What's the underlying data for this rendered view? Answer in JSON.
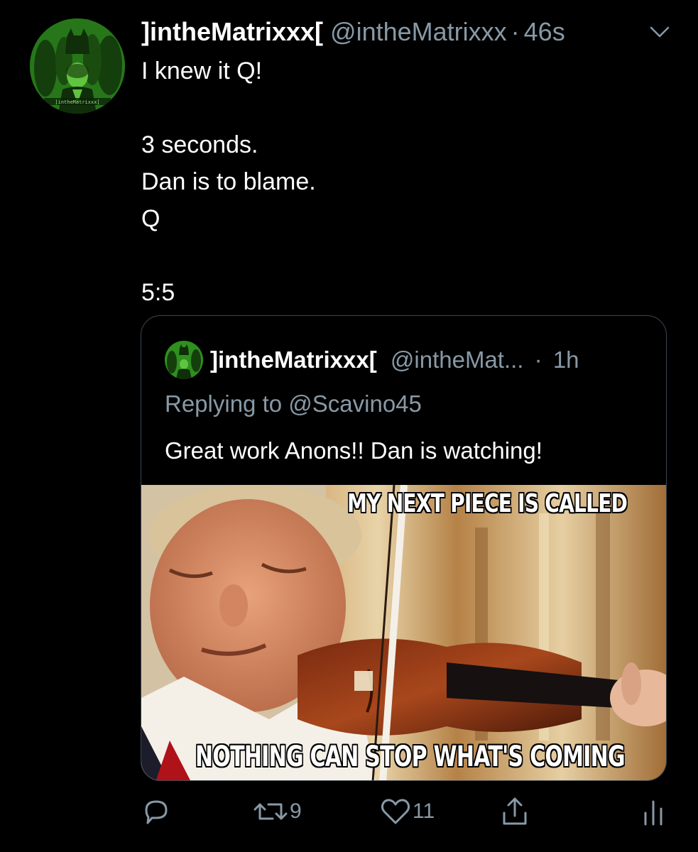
{
  "tweet": {
    "display_name": "]intheMatrixxx[",
    "handle": "@intheMatrixxx",
    "separator": "·",
    "time": "46s",
    "body_lines": [
      "I knew it Q!",
      "",
      "3 seconds.",
      "Dan is to blame.",
      "Q",
      "",
      "5:5"
    ],
    "line_1": "I knew it Q!",
    "line_3": "3 seconds.",
    "line_4": "Dan is to blame.",
    "line_5": "Q",
    "line_7": "5:5",
    "avatar_caption": "]intheMatrixxx["
  },
  "quoted_tweet": {
    "display_name": "]intheMatrixxx[",
    "handle": "@intheMat...",
    "separator": "·",
    "time": "1h",
    "replying_to": "Replying to @Scavino45",
    "text": "Great work Anons!! Dan is watching!",
    "meme_top_text": "MY NEXT PIECE IS CALLED",
    "meme_bottom_text": "NOTHING CAN STOP WHAT'S COMING"
  },
  "actions": {
    "reply_icon": "reply-icon",
    "retweet_icon": "retweet-icon",
    "retweet_count": "9",
    "like_icon": "heart-icon",
    "like_count": "11",
    "share_icon": "share-icon",
    "analytics_icon": "analytics-icon"
  },
  "colors": {
    "background": "#000000",
    "text_primary": "#ffffff",
    "text_secondary": "#8899a6",
    "border": "#3d4751",
    "avatar_green": "#2f8f1f"
  }
}
